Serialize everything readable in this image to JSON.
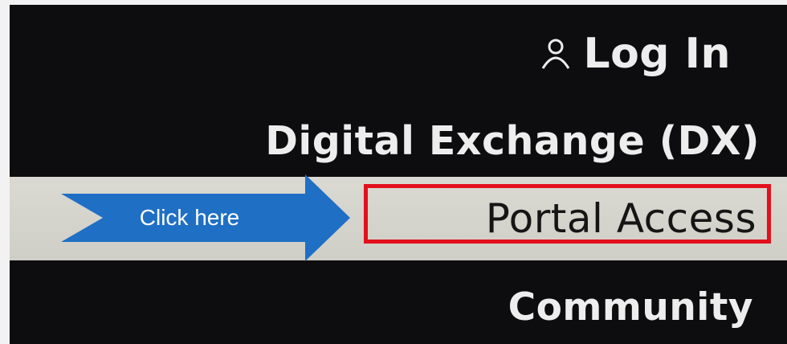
{
  "menu": {
    "login_label": "Log In",
    "login_icon": "user-icon",
    "digital_exchange_label": "Digital Exchange (DX)",
    "portal_access_label": "Portal Access",
    "community_label": "Community"
  },
  "annotation": {
    "arrow_text": "Click here",
    "arrow_color": "#1f6fc5",
    "highlight_color": "#e3101c"
  }
}
